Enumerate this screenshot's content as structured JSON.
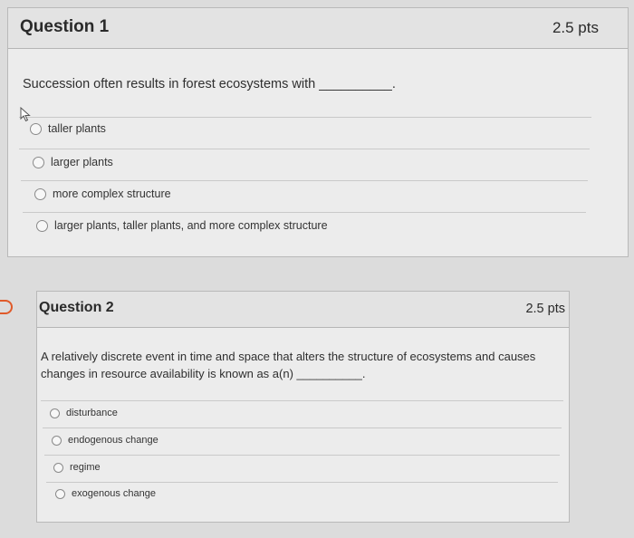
{
  "questions": [
    {
      "title": "Question 1",
      "points": "2.5 pts",
      "text": "Succession often results in forest ecosystems with __________.",
      "answers": [
        "taller plants",
        "larger plants",
        "more complex structure",
        "larger plants, taller plants, and more complex structure"
      ]
    },
    {
      "title": "Question 2",
      "points": "2.5 pts",
      "text": "A relatively discrete event in time and space that alters the structure of ecosystems and causes changes in resource availability is known as a(n) __________.",
      "answers": [
        "disturbance",
        "endogenous change",
        "regime",
        "exogenous change"
      ]
    }
  ],
  "colors": {
    "accent": "#e05a2a",
    "card_bg": "#ececec",
    "header_bg": "#e3e3e3"
  },
  "icons": [
    "pointer-cursor-icon",
    "bookmark-flag-icon",
    "radio-unchecked-icon"
  ]
}
